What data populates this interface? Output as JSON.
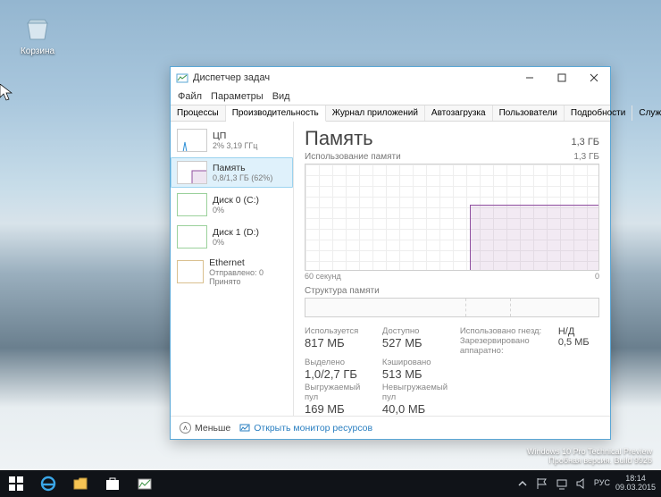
{
  "desktop": {
    "recycle_bin_label": "Корзина",
    "watermark_line1": "Windows 10 Pro Technical Preview",
    "watermark_line2": "Пробная версия. Build 9926"
  },
  "window": {
    "title": "Диспетчер задач",
    "menu": [
      "Файл",
      "Параметры",
      "Вид"
    ],
    "tabs": [
      "Процессы",
      "Производительность",
      "Журнал приложений",
      "Автозагрузка",
      "Пользователи",
      "Подробности",
      "Службы"
    ],
    "active_tab": 1
  },
  "sidebar": {
    "items": [
      {
        "name": "ЦП",
        "sub": "2% 3,19 ГГц",
        "color": "#2d8fd6"
      },
      {
        "name": "Память",
        "sub": "0,8/1,3 ГБ (62%)",
        "color": "#9050a0"
      },
      {
        "name": "Диск 0 (C:)",
        "sub": "0%",
        "color": "#69b36b"
      },
      {
        "name": "Диск 1 (D:)",
        "sub": "0%",
        "color": "#69b36b"
      },
      {
        "name": "Ethernet",
        "sub": "Отправлено: 0 Принято",
        "color": "#b88a3a"
      }
    ],
    "active": 1
  },
  "panel": {
    "title": "Память",
    "total": "1,3 ГБ",
    "usage_label": "Использование памяти",
    "usage_right": "1,3 ГБ",
    "x_left": "60 секунд",
    "x_right": "0",
    "struct_label": "Структура памяти",
    "stats": {
      "in_use_label": "Используется",
      "in_use": "817 МБ",
      "avail_label": "Доступно",
      "avail": "527 МБ",
      "sockets_label": "Использовано гнезд:",
      "sockets": "Н/Д",
      "hw_label": "Зарезервировано аппаратно:",
      "hw": "0,5 МБ",
      "commit_label": "Выделено",
      "commit": "1,0/2,7 ГБ",
      "cached_label": "Кэшировано",
      "cached": "513 МБ",
      "paged_label": "Выгружаемый пул",
      "paged": "169 МБ",
      "nonpaged_label": "Невыгружаемый пул",
      "nonpaged": "40,0 МБ"
    }
  },
  "footer": {
    "fewer": "Меньше",
    "open_resmon": "Открыть монитор ресурсов"
  },
  "taskbar": {
    "lang": "РУС",
    "time": "18:14",
    "date": "09.03.2015"
  },
  "chart_data": {
    "type": "area",
    "title": "Использование памяти",
    "ylabel": "ГБ",
    "ylim": [
      0,
      1.3
    ],
    "xlabel": "секунд",
    "x_range": [
      60,
      0
    ],
    "series": [
      {
        "name": "Память",
        "color": "#9050a0",
        "x": [
          60,
          28,
          27,
          0
        ],
        "values": [
          0,
          0,
          0.81,
          0.8
        ]
      }
    ],
    "struct_segments_pct": [
      55,
      15,
      30
    ]
  }
}
